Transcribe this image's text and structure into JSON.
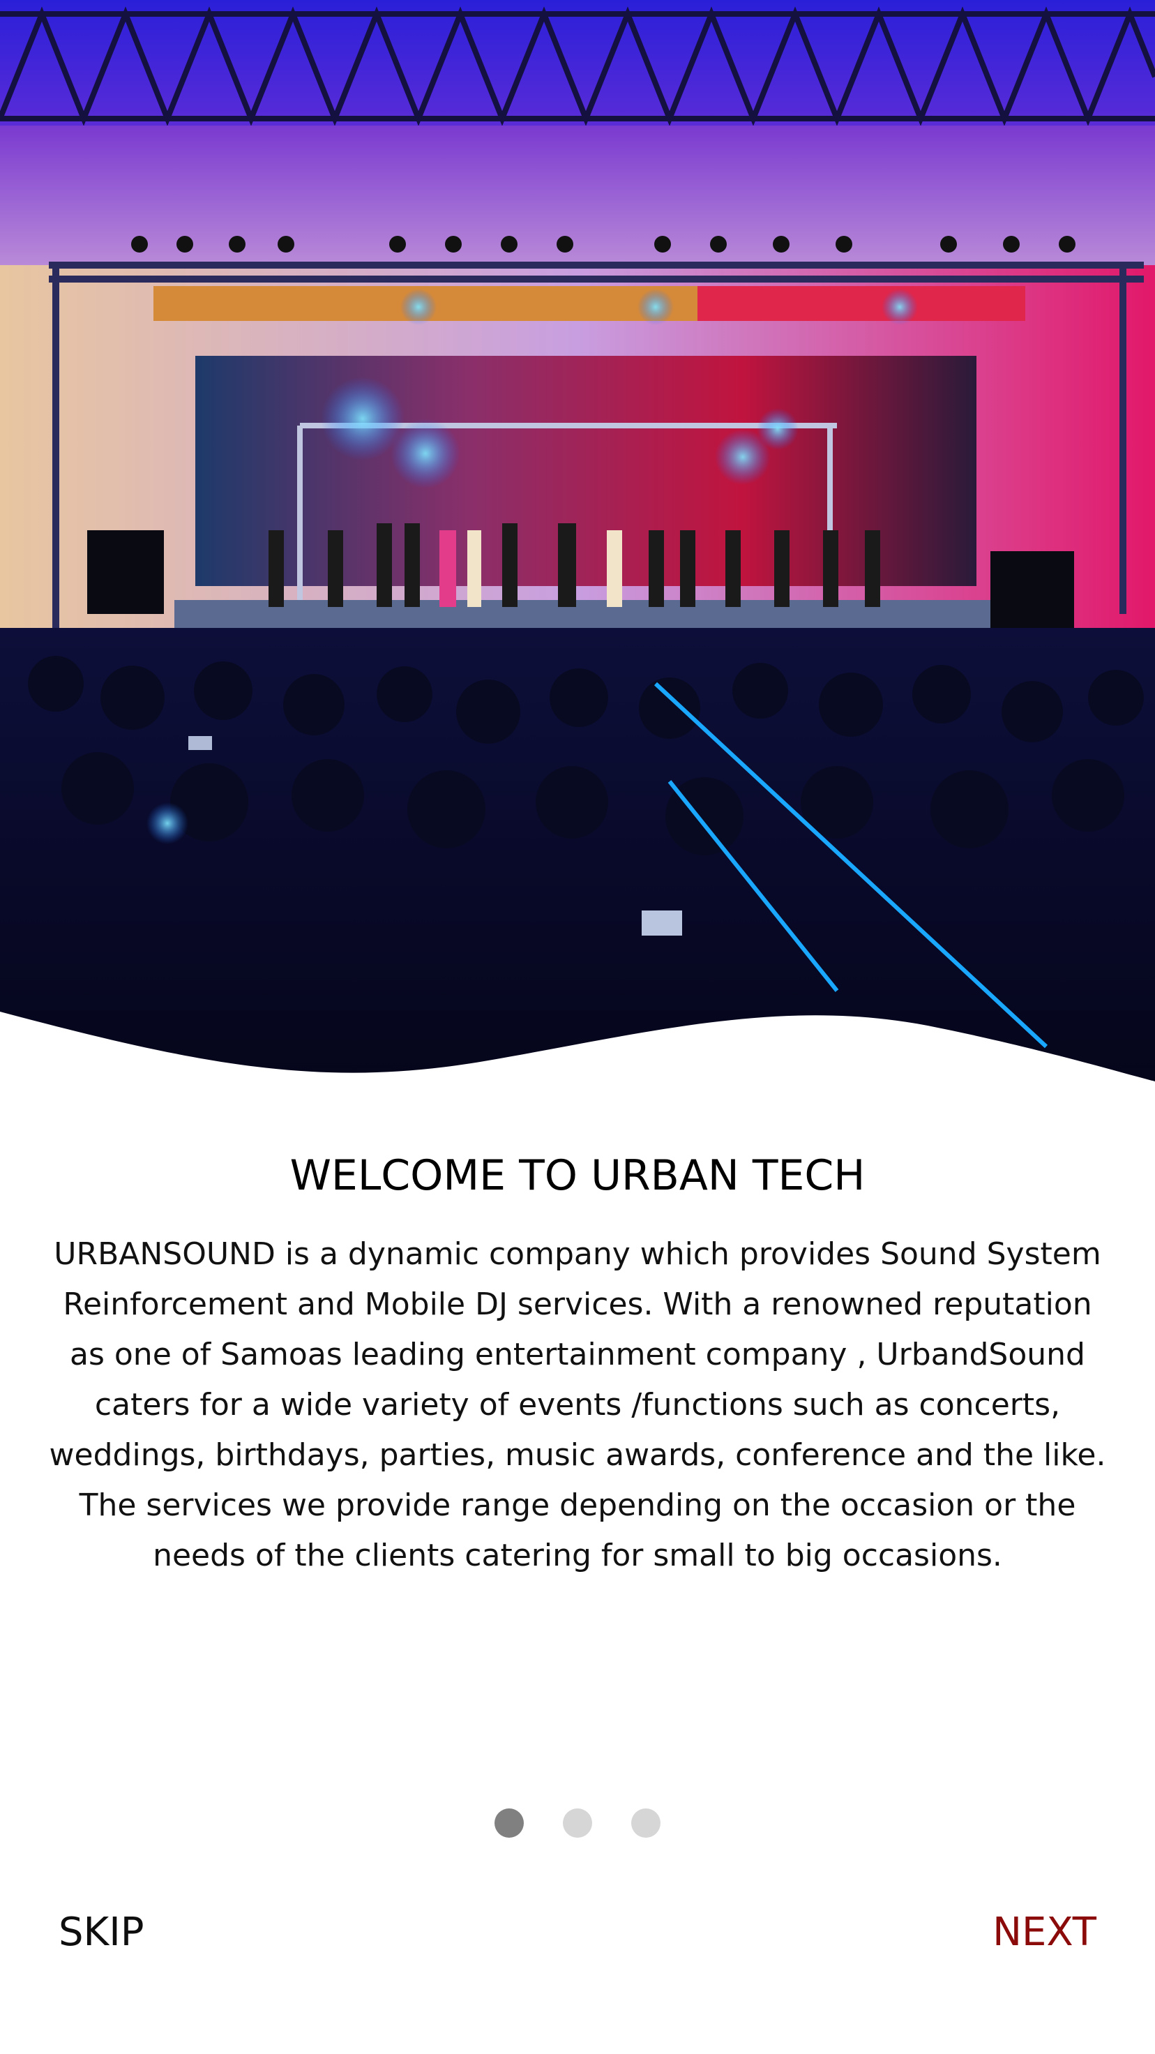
{
  "onboarding": {
    "title": "WELCOME TO URBAN TECH",
    "description": "URBANSOUND is a dynamic company which provides Sound System Reinforcement and Mobile DJ services. With a renowned reputation as one of Samoas leading entertainment company , UrbandSound caters for a wide variety of events /functions such as concerts, weddings, birthdays, parties, music awards, conference and the like. The services we provide range depending on the occasion or the needs of the clients catering for small to big occasions.",
    "hero_image": "concert-stage-photo",
    "pager": {
      "total": 3,
      "active_index": 0,
      "active_color": "#808080",
      "inactive_color": "#d6d6d6"
    },
    "skip_label": "SKIP",
    "next_label": "NEXT",
    "next_color": "#8b0a0a"
  }
}
